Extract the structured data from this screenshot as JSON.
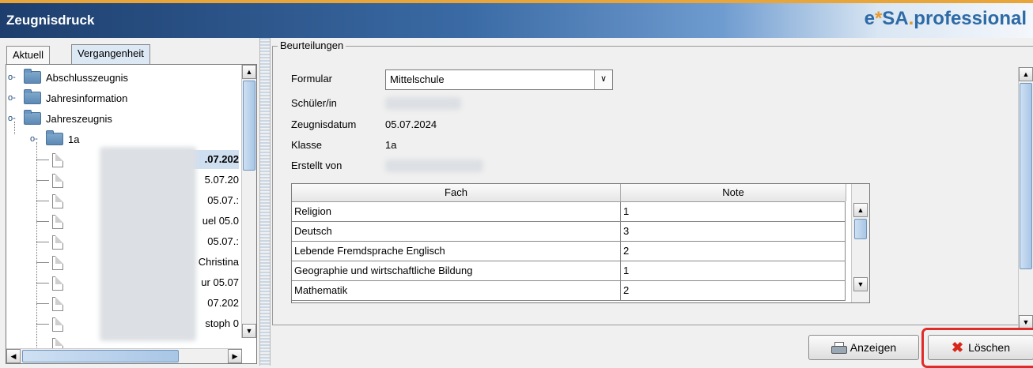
{
  "window": {
    "title": "Zeugnisdruck",
    "brand_prefix": "e",
    "brand_star": "*",
    "brand_mid": "SA",
    "brand_dot": ".",
    "brand_suffix": "professional"
  },
  "tabs": [
    {
      "label": "Aktuell"
    },
    {
      "label": "Vergangenheit"
    }
  ],
  "tree": {
    "folders": [
      "Abschlusszeugnis",
      "Jahresinformation",
      "Jahreszeugnis"
    ],
    "subfolder": "1a",
    "leaves": [
      ".07.202",
      "5.07.20",
      "05.07.:",
      "uel 05.0",
      "05.07.:",
      "Christina",
      "ur 05.07",
      "07.202",
      "stoph 0"
    ]
  },
  "form": {
    "group_title": "Beurteilungen",
    "formular_label": "Formular",
    "formular_value": "Mittelschule",
    "schueler_label": "Schüler/in",
    "datum_label": "Zeugnisdatum",
    "datum_value": "05.07.2024",
    "klasse_label": "Klasse",
    "klasse_value": "1a",
    "erstellt_label": "Erstellt von"
  },
  "grades": {
    "columns": [
      "Fach",
      "Note"
    ],
    "rows": [
      {
        "fach": "Religion",
        "note": "1"
      },
      {
        "fach": "Deutsch",
        "note": "3"
      },
      {
        "fach": "Lebende Fremdsprache Englisch",
        "note": "2"
      },
      {
        "fach": "Geographie und wirtschaftliche Bildung",
        "note": "1"
      },
      {
        "fach": "Mathematik",
        "note": "2"
      }
    ]
  },
  "buttons": {
    "anzeigen": "Anzeigen",
    "loeschen": "Löschen"
  },
  "icons": {
    "print": "printer-icon",
    "delete": "delete-x-icon"
  },
  "colors": {
    "title_bar": "#1d3e6d",
    "highlight": "#e02b2b",
    "brand_blue": "#2d6aa6",
    "brand_orange": "#e89a2a"
  }
}
